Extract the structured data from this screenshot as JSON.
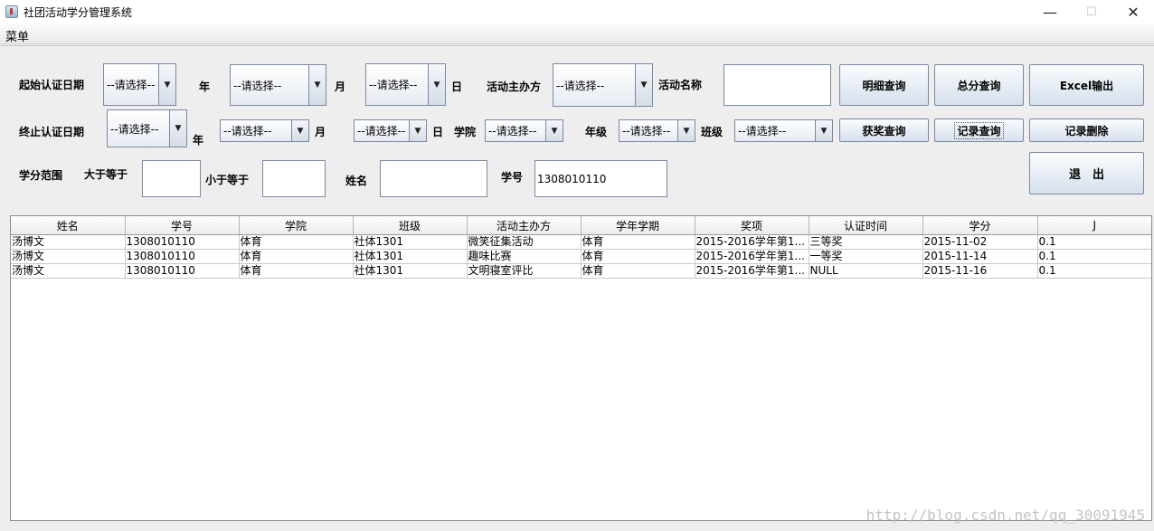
{
  "window": {
    "title": "社团活动学分管理系统"
  },
  "menu": {
    "items": [
      "菜单"
    ]
  },
  "filters": {
    "start_date_label": "起始认证日期",
    "end_date_label": "终止认证日期",
    "year_label": "年",
    "month_label": "月",
    "day_label": "日",
    "organizer_label": "活动主办方",
    "activity_name_label": "活动名称",
    "college_label": "学院",
    "grade_label": "年级",
    "class_label": "班级",
    "credit_range_label": "学分范围",
    "gte_label": "大于等于",
    "lte_label": "小于等于",
    "name_label": "姓名",
    "student_id_label": "学号",
    "combo_placeholder": "--请选择--",
    "activity_name_value": "",
    "gte_value": "",
    "lte_value": "",
    "name_value": "",
    "student_id_value": "1308010110"
  },
  "buttons": {
    "detail_query": "明细查询",
    "total_query": "总分查询",
    "excel_export": "Excel输出",
    "award_query": "获奖查询",
    "record_query": "记录查询",
    "record_delete": "记录删除",
    "exit": "退　出"
  },
  "table": {
    "columns": [
      "姓名",
      "学号",
      "学院",
      "班级",
      "活动主办方",
      "学年学期",
      "奖项",
      "认证时间",
      "学分",
      "J"
    ],
    "rows": [
      [
        "汤博文",
        "1308010110",
        "体育",
        "社体1301",
        "微笑征集活动",
        "体育",
        "2015-2016学年第1...",
        "三等奖",
        "2015-11-02",
        "0.1"
      ],
      [
        "汤博文",
        "1308010110",
        "体育",
        "社体1301",
        "趣味比赛",
        "体育",
        "2015-2016学年第1...",
        "一等奖",
        "2015-11-14",
        "0.1"
      ],
      [
        "汤博文",
        "1308010110",
        "体育",
        "社体1301",
        "文明寝室评比",
        "体育",
        "2015-2016学年第1...",
        "NULL",
        "2015-11-16",
        "0.1"
      ]
    ]
  },
  "watermark": "http://blog.csdn.net/qq_30091945"
}
